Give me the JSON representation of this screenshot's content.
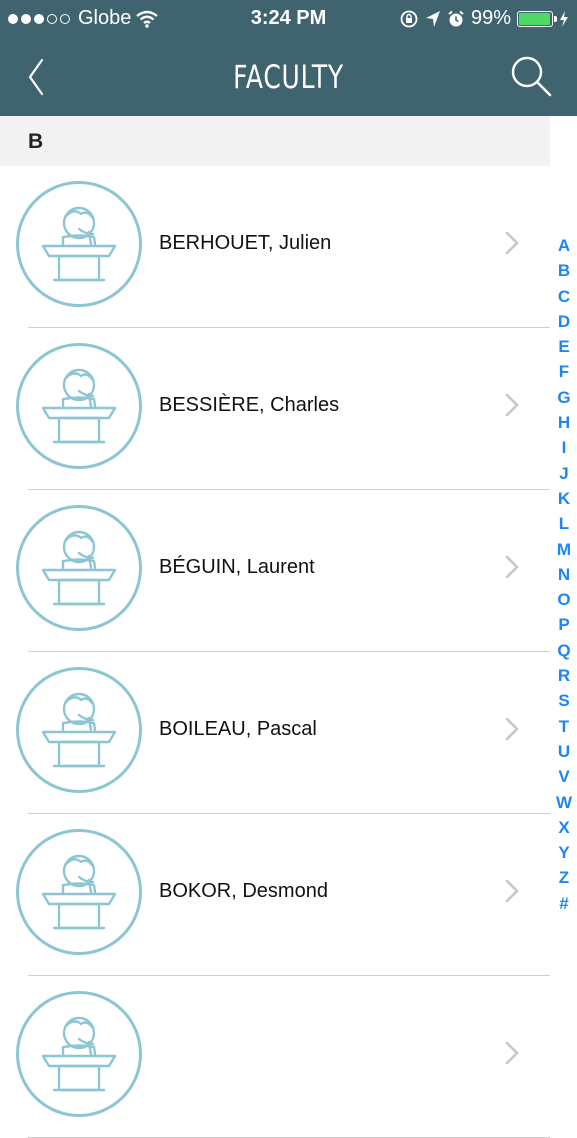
{
  "status_bar": {
    "carrier": "Globe",
    "time": "3:24 PM",
    "battery_percent": "99%",
    "signal_dots_filled": 3,
    "signal_dots_total": 5,
    "battery_level": 0.99,
    "battery_color": "#4cd964"
  },
  "nav": {
    "title": "FACULTY",
    "back_icon": "chevron-left-icon",
    "search_icon": "search-icon",
    "background": "#3f6470"
  },
  "section": {
    "letter": "B"
  },
  "faculty": [
    {
      "name": "BERHOUET, Julien"
    },
    {
      "name": "BESSIÈRE, Charles"
    },
    {
      "name": "BÉGUIN, Laurent"
    },
    {
      "name": "BOILEAU, Pascal"
    },
    {
      "name": "BOKOR, Desmond"
    },
    {
      "name": ""
    }
  ],
  "index": [
    "A",
    "B",
    "C",
    "D",
    "E",
    "F",
    "G",
    "H",
    "I",
    "J",
    "K",
    "L",
    "M",
    "N",
    "O",
    "P",
    "Q",
    "R",
    "S",
    "T",
    "U",
    "V",
    "W",
    "X",
    "Y",
    "Z",
    "#"
  ],
  "colors": {
    "accent": "#1e86f0",
    "avatar": "#8cc6d3"
  }
}
